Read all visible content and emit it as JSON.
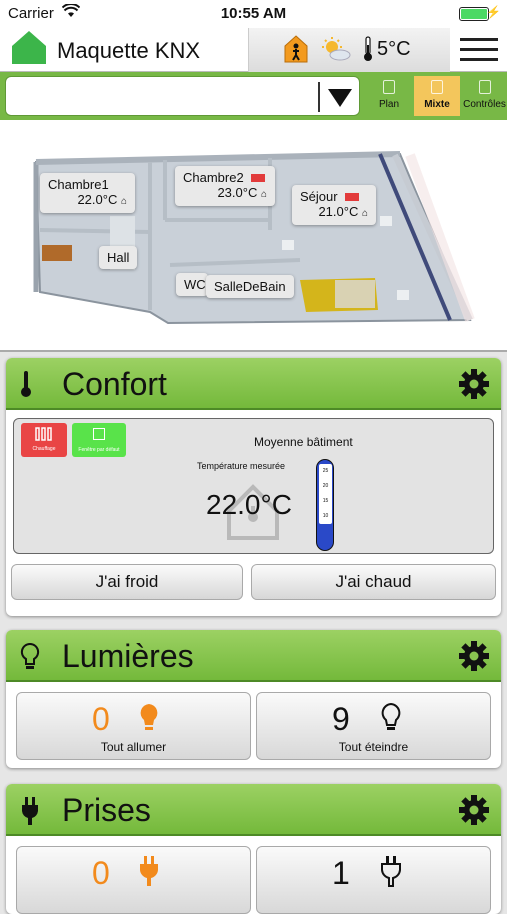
{
  "status_bar": {
    "carrier": "Carrier",
    "time": "10:55 AM"
  },
  "header": {
    "title": "Maquette KNX",
    "outdoor_temp": "5°C",
    "brand_color": "#3cb54a"
  },
  "toolbar": {
    "room_selector_value": "",
    "modes": [
      {
        "label": "Plan",
        "active": false
      },
      {
        "label": "Mixte",
        "active": true
      },
      {
        "label": "Contrôles",
        "active": false
      }
    ]
  },
  "floorplan": {
    "rooms": [
      {
        "name": "Chambre1",
        "temp": "22.0°C"
      },
      {
        "name": "Chambre2",
        "temp": "23.0°C"
      },
      {
        "name": "Séjour",
        "temp": "21.0°C"
      },
      {
        "name": "Hall",
        "temp": ""
      },
      {
        "name": "WC",
        "temp": ""
      },
      {
        "name": "SalleDeBain",
        "temp": ""
      }
    ]
  },
  "confort": {
    "title": "Confort",
    "mode_heating_label": "Chauffage",
    "mode_window_label": "Fenêtre par défaut",
    "average_label": "Moyenne bâtiment",
    "measured_label": "Température mesurée",
    "measured_value": "22.0°C",
    "thermometer_scale": [
      "25",
      "20",
      "15",
      "10"
    ],
    "cold_button": "J'ai froid",
    "hot_button": "J'ai chaud"
  },
  "lumieres": {
    "title": "Lumières",
    "on_count": "0",
    "on_label": "Tout allumer",
    "off_count": "9",
    "off_label": "Tout éteindre"
  },
  "prises": {
    "title": "Prises",
    "on_count": "0",
    "off_count": "1"
  }
}
